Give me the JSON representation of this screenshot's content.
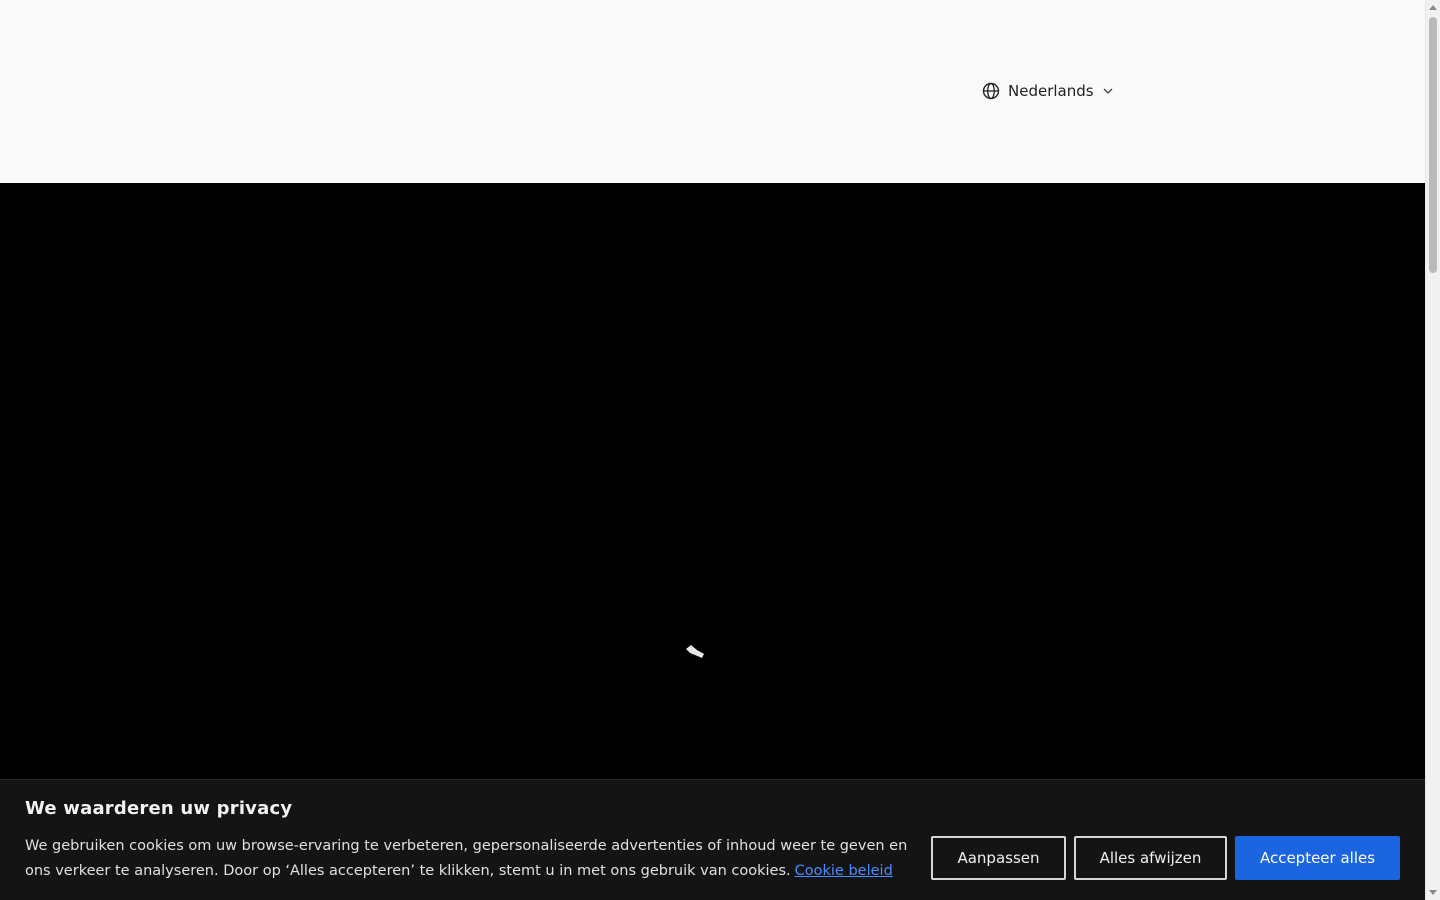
{
  "header": {
    "language": {
      "label": "Nederlands",
      "globe_icon": "globe-icon",
      "chevron_icon": "chevron-down-icon"
    }
  },
  "hero": {
    "state": "loading",
    "spinner_icon": "loading-spinner-icon"
  },
  "cookie_banner": {
    "title": "We waarderen uw privacy",
    "text": "We gebruiken cookies om uw browse-ervaring te verbeteren, gepersonaliseerde advertenties of inhoud weer te geven en ons verkeer te analyseren. Door op ‘Alles accepteren’ te klikken, stemt u in met ons gebruik van cookies.",
    "policy_link": "Cookie beleid",
    "buttons": {
      "customize": "Aanpassen",
      "reject": "Alles afwijzen",
      "accept": "Accepteer alles"
    },
    "colors": {
      "background": "#141414",
      "accent": "#1b66e0",
      "link": "#4a8cff"
    }
  }
}
